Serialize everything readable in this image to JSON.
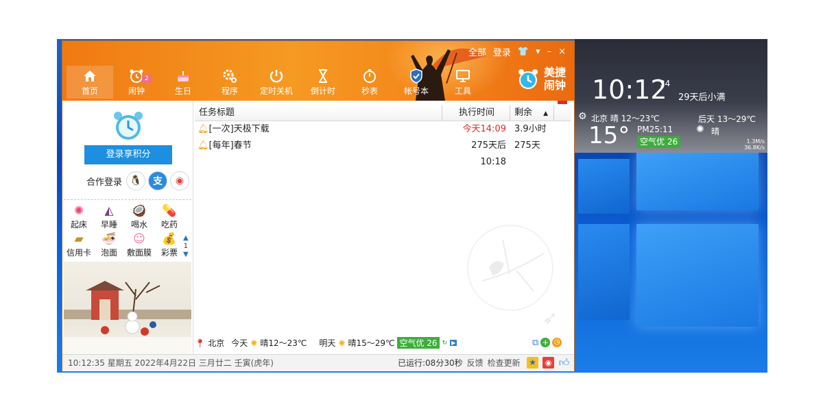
{
  "header": {
    "topbar": {
      "all": "全部",
      "login": "登录"
    },
    "brand": {
      "line1": "美捷",
      "line2": "闹钟"
    },
    "nav": [
      {
        "label": "首页",
        "icon": "home-icon"
      },
      {
        "label": "闹钟",
        "icon": "alarm-clock-icon",
        "badge": "2"
      },
      {
        "label": "生日",
        "icon": "birthday-cake-icon"
      },
      {
        "label": "程序",
        "icon": "gear-icon"
      },
      {
        "label": "定时关机",
        "icon": "power-icon"
      },
      {
        "label": "倒计时",
        "icon": "hourglass-icon"
      },
      {
        "label": "秒表",
        "icon": "stopwatch-icon"
      },
      {
        "label": "帐号本",
        "icon": "shield-icon"
      },
      {
        "label": "工具",
        "icon": "monitor-icon"
      }
    ]
  },
  "left": {
    "login_button": "登录享积分",
    "coop_label": "合作登录",
    "quick": [
      {
        "label": "起床",
        "icon": "sun-icon"
      },
      {
        "label": "早睡",
        "icon": "moon-icon"
      },
      {
        "label": "喝水",
        "icon": "drink-icon"
      },
      {
        "label": "吃药",
        "icon": "medicine-icon"
      },
      {
        "label": "信用卡",
        "icon": "credit-card-icon"
      },
      {
        "label": "泡面",
        "icon": "noodles-icon"
      },
      {
        "label": "敷面膜",
        "icon": "face-mask-icon"
      },
      {
        "label": "彩票",
        "icon": "money-bag-icon"
      }
    ],
    "page": "1"
  },
  "table": {
    "columns": [
      "任务标题",
      "执行时间",
      "剩余"
    ],
    "rows": [
      {
        "title": "[一次]天极下载",
        "time": "今天14:09",
        "remain": "3.9小时",
        "time_color": "#e02a2a"
      },
      {
        "title": "[每年]春节",
        "time": "275天后10:18",
        "remain": "275天",
        "time_color": "#222222"
      }
    ]
  },
  "weather_strip": {
    "city": "北京",
    "today_label": "今天",
    "today": "晴12～23℃",
    "tomorrow_label": "明天",
    "tomorrow": "晴15～29℃",
    "air": "空气优 26"
  },
  "status": {
    "datetime": "10:12:35 星期五 2022年4月22日 三月廿二 壬寅(虎年)",
    "runtime": "已运行:08分30秒",
    "feedback": "反馈",
    "update": "检查更新"
  },
  "widget": {
    "time": "10:12",
    "seconds": "34",
    "note": "29天后小满",
    "city_line": "北京 晴 12～23℃",
    "after_line": "后天 13～29℃",
    "temp": "15°",
    "pm": "PM25:11",
    "after_weather": "晴",
    "air": "空气优 26",
    "speed_up": "1.3M/s",
    "speed_down": "36.8K/s"
  },
  "colors": {
    "header_orange": "#f4871a",
    "login_blue": "#1e8fe0",
    "air_green": "#3cae3a",
    "alert_red": "#e02a2a"
  }
}
